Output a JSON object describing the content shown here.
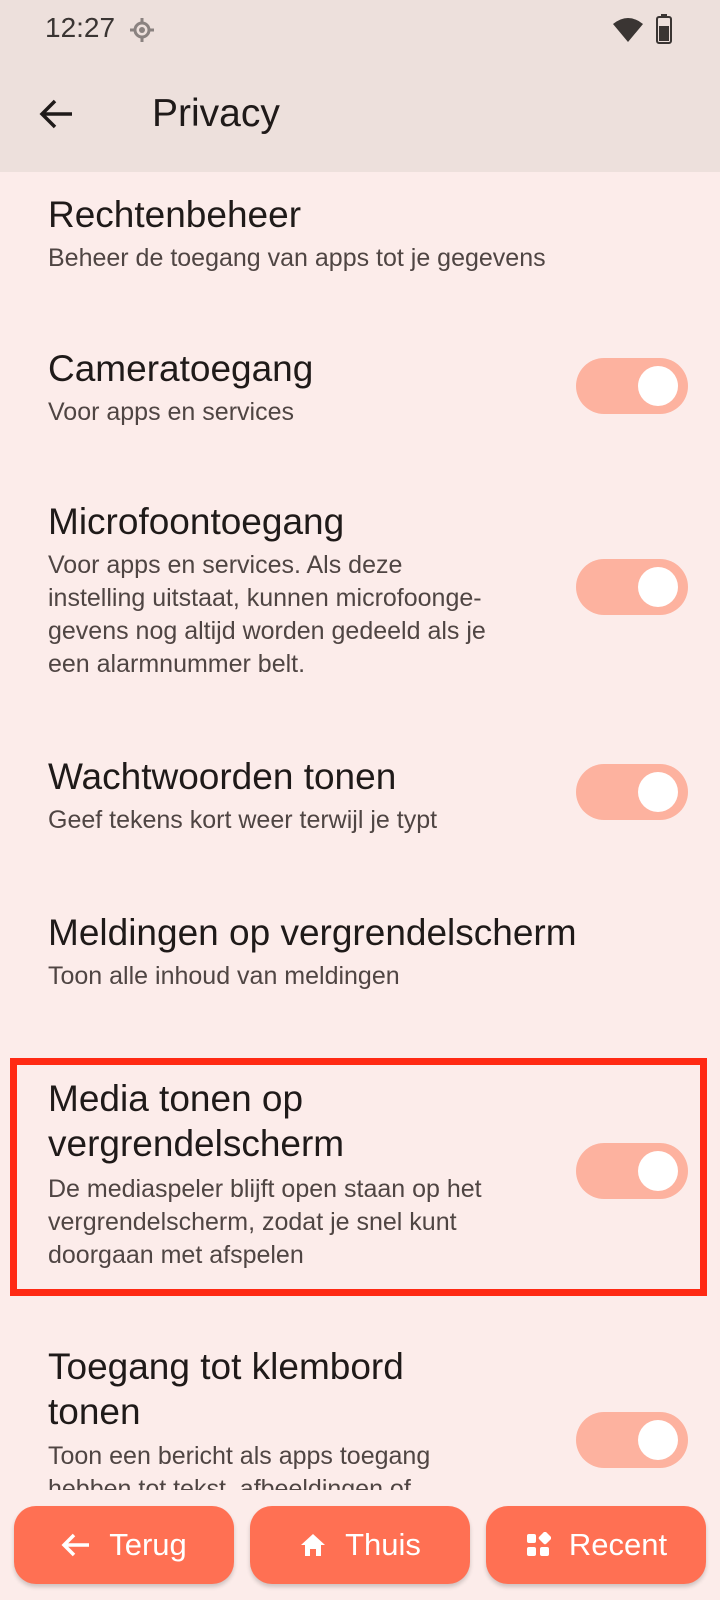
{
  "status_bar": {
    "time": "12:27"
  },
  "app_bar": {
    "title": "Privacy"
  },
  "items": [
    {
      "title": "Rechtenbeheer",
      "subtitle": "Beheer de toegang van apps tot je gegevens",
      "has_toggle": false
    },
    {
      "title": "Cameratoegang",
      "subtitle": "Voor apps en services",
      "has_toggle": true,
      "toggle_on": true
    },
    {
      "title": "Microfoontoegang",
      "subtitle_lines": [
        "Voor apps en services. Als deze",
        "instelling uitstaat, kunnen microfoonge-",
        "gevens nog altijd worden gedeeld als je",
        "een alarmnummer belt."
      ],
      "has_toggle": true,
      "toggle_on": true
    },
    {
      "title": "Wachtwoorden tonen",
      "subtitle": "Geef tekens kort weer terwijl je typt",
      "has_toggle": true,
      "toggle_on": true
    },
    {
      "title": "Meldingen op vergrendelscherm",
      "subtitle": "Toon alle inhoud van meldingen",
      "has_toggle": false
    },
    {
      "title_lines": [
        "Media tonen op",
        "vergrendelscherm"
      ],
      "subtitle_lines": [
        "De mediaspeler blijft open staan op het",
        "vergrendelscherm, zodat je snel kunt",
        "doorgaan met afspelen"
      ],
      "has_toggle": true,
      "toggle_on": true,
      "highlighted": true
    },
    {
      "title_lines": [
        "Toegang tot klembord",
        "tonen"
      ],
      "subtitle_lines": [
        "Toon een bericht als apps toegang",
        "hebben tot tekst, afbeeldingen of"
      ],
      "has_toggle": true,
      "toggle_on": true
    }
  ],
  "nav": {
    "back_label": "Terug",
    "home_label": "Thuis",
    "recent_label": "Recent"
  },
  "colors": {
    "background": "#fcecea",
    "app_bar": "#ede0dc",
    "toggle_track": "#fdb29f",
    "highlight_border": "#ff2a14",
    "nav_button": "#ff7053"
  }
}
